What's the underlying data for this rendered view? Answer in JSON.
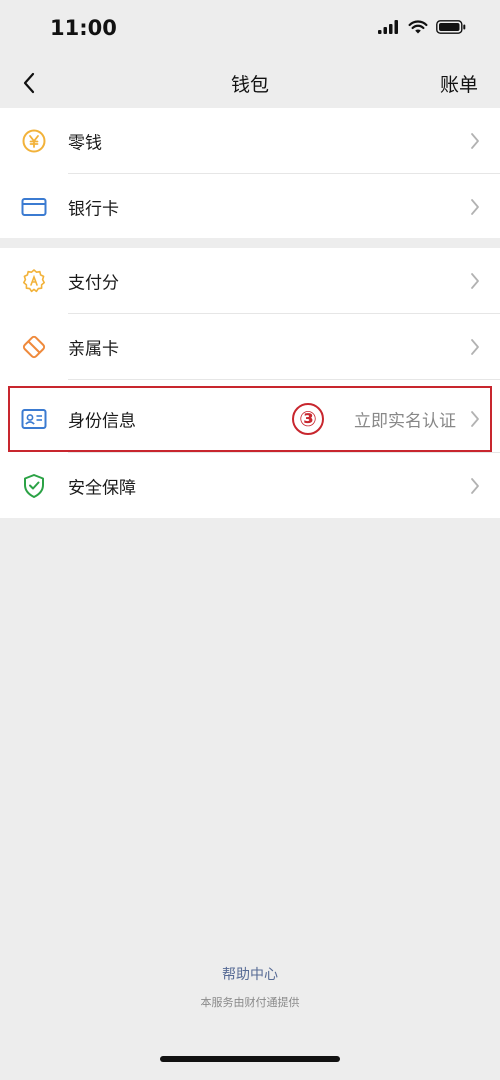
{
  "status_bar": {
    "time": "11:00",
    "icons": [
      "signal-icon",
      "wifi-icon",
      "battery-icon"
    ]
  },
  "nav": {
    "title": "钱包",
    "right_action": "账单",
    "back_icon": "chevron-left-icon"
  },
  "groups": [
    {
      "items": [
        {
          "label": "零钱",
          "icon": "yuan-coin-icon",
          "icon_color": "#f2b23a"
        },
        {
          "label": "银行卡",
          "icon": "bank-card-icon",
          "icon_color": "#3b7bd1"
        }
      ]
    },
    {
      "items": [
        {
          "label": "支付分",
          "icon": "payment-score-icon",
          "icon_color": "#f2b23a"
        },
        {
          "label": "亲属卡",
          "icon": "family-card-icon",
          "icon_color": "#ef8a3c"
        },
        {
          "label": "身份信息",
          "icon": "id-card-icon",
          "icon_color": "#3b7bd1",
          "value": "立即实名认证",
          "annotation": "③"
        },
        {
          "label": "安全保障",
          "icon": "shield-icon",
          "icon_color": "#2ba245"
        }
      ]
    }
  ],
  "footer": {
    "help_link": "帮助中心",
    "note": "本服务由财付通提供"
  },
  "colors": {
    "background": "#ededed",
    "highlight": "#c8262e",
    "link": "#576b95"
  }
}
